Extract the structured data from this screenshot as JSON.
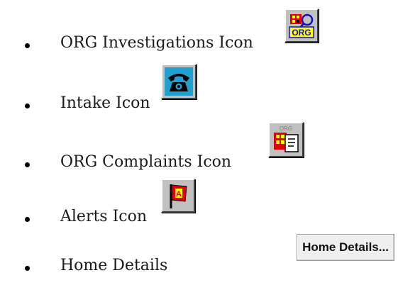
{
  "list": {
    "items": [
      {
        "label": "ORG Investigations Icon",
        "icon": "org-investigations-icon"
      },
      {
        "label": "Intake Icon",
        "icon": "telephone-icon"
      },
      {
        "label": "ORG Complaints Icon",
        "icon": "org-complaints-icon"
      },
      {
        "label": "Alerts Icon",
        "icon": "alert-flag-icon"
      },
      {
        "label": "Home Details",
        "button": "Home Details..."
      }
    ]
  },
  "colors": {
    "icon_face": "#c0c0c0",
    "org_blue": "#1010c0",
    "alert_red": "#e00000",
    "alert_yellow": "#ffff00"
  }
}
